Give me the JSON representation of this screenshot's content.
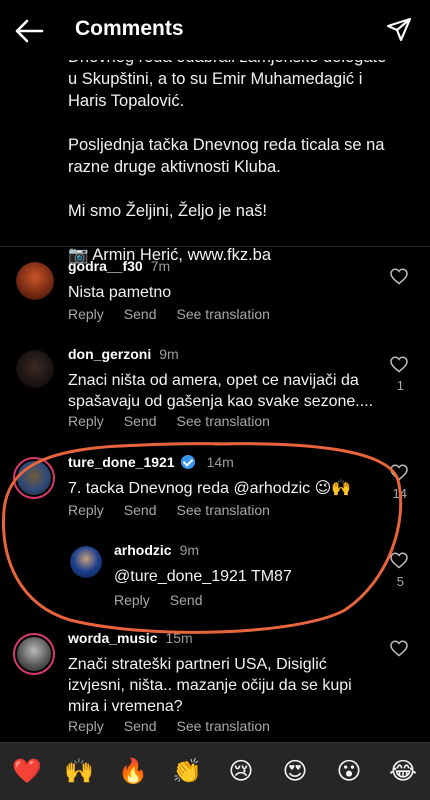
{
  "header": {
    "title": "Comments",
    "back_icon": "arrow-left-icon",
    "share_icon": "paper-plane-icon"
  },
  "caption": {
    "lines_cut": "Dnevnog reda odabrali zamjenske delegate u Skupštini, a to su Emir Muhamedagić i Haris Topalović.",
    "para2": "Posljednja tačka Dnevnog reda ticala se na razne druge aktivnosti Kluba.",
    "para3": "Mi smo Željini, Željo je naš!",
    "credit_icon": "📷",
    "credit": "Armin Herić, www.fkz.ba"
  },
  "actions": {
    "reply": "Reply",
    "send": "Send",
    "see_translation": "See translation"
  },
  "comments": [
    {
      "user": "godra__f30",
      "time": "7m",
      "text": "Nista pametno",
      "likes": ""
    },
    {
      "user": "don_gerzoni",
      "time": "9m",
      "text": "Znaci ništa od amera,  opet ce navijači da spašavaju od gašenja kao svake sezone....",
      "likes": "1"
    },
    {
      "user": "ture_done_1921",
      "time": "14m",
      "text": "7. tacka Dnevnog reda @arhodzic 😉🙌",
      "likes": "14",
      "verified": true
    },
    {
      "user": "worda_music",
      "time": "15m",
      "text": "Znači strateški partneri USA, Disiglić izvjesni, ništa.. mazanje očiju da se kupi mira i vremena?",
      "likes": ""
    }
  ],
  "reply": {
    "user": "arhodzic",
    "time": "9m",
    "text": "@ture_done_1921 TM87",
    "likes": "5"
  },
  "emoji_bar": [
    "❤️",
    "🙌",
    "🔥",
    "👏",
    "😢",
    "😍",
    "😮",
    "😂"
  ],
  "colors": {
    "background": "#000000",
    "annotation": "#e8643c",
    "verified": "#3897f0",
    "story_ring": "#d63b6a"
  }
}
